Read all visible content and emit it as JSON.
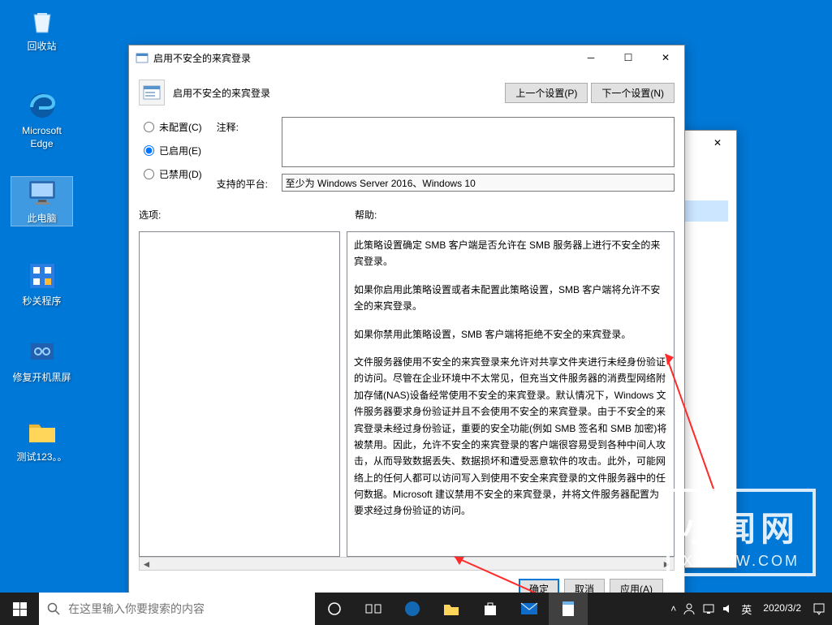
{
  "desktop": {
    "icons": [
      {
        "name": "recycle-bin",
        "label": "回收站"
      },
      {
        "name": "edge",
        "label": "Microsoft Edge"
      },
      {
        "name": "this-pc",
        "label": "此电脑"
      },
      {
        "name": "quick-close",
        "label": "秒关程序"
      },
      {
        "name": "repair-boot",
        "label": "修复开机黑屏"
      },
      {
        "name": "test-folder",
        "label": "测试123。。"
      }
    ]
  },
  "taskbar": {
    "search_placeholder": "在这里输入你要搜索的内容",
    "clock_time": "",
    "clock_date": "2020/3/2"
  },
  "dialog": {
    "title": "启用不安全的来宾登录",
    "policy_name": "启用不安全的来宾登录",
    "nav_prev": "上一个设置(P)",
    "nav_next": "下一个设置(N)",
    "radio_not_configured": "未配置(C)",
    "radio_enabled": "已启用(E)",
    "radio_disabled": "已禁用(D)",
    "selected_radio": "enabled",
    "label_comment": "注释:",
    "comment_value": "",
    "label_supported": "支持的平台:",
    "supported_value": "至少为 Windows Server 2016、Windows 10",
    "label_options": "选项:",
    "label_help": "帮助:",
    "help_paragraphs": [
      "此策略设置确定 SMB 客户端是否允许在 SMB 服务器上进行不安全的来宾登录。",
      "如果你启用此策略设置或者未配置此策略设置，SMB 客户端将允许不安全的来宾登录。",
      "如果你禁用此策略设置，SMB 客户端将拒绝不安全的来宾登录。",
      "文件服务器使用不安全的来宾登录来允许对共享文件夹进行未经身份验证的访问。尽管在企业环境中不太常见，但充当文件服务器的消费型网络附加存储(NAS)设备经常使用不安全的来宾登录。默认情况下，Windows 文件服务器要求身份验证并且不会使用不安全的来宾登录。由于不安全的来宾登录未经过身份验证，重要的安全功能(例如 SMB 签名和 SMB 加密)将被禁用。因此，允许不安全的来宾登录的客户端很容易受到各种中间人攻击，从而导致数据丢失、数据损坏和遭受恶意软件的攻击。此外，可能网络上的任何人都可以访问写入到使用不安全来宾登录的文件服务器中的任何数据。Microsoft 建议禁用不安全的来宾登录，并将文件服务器配置为要求经过身份验证的访问。"
    ],
    "btn_ok": "确定",
    "btn_cancel": "取消",
    "btn_apply": "应用(A)"
  },
  "watermark": {
    "text": "小闻网",
    "url": "XWENW.COM"
  }
}
